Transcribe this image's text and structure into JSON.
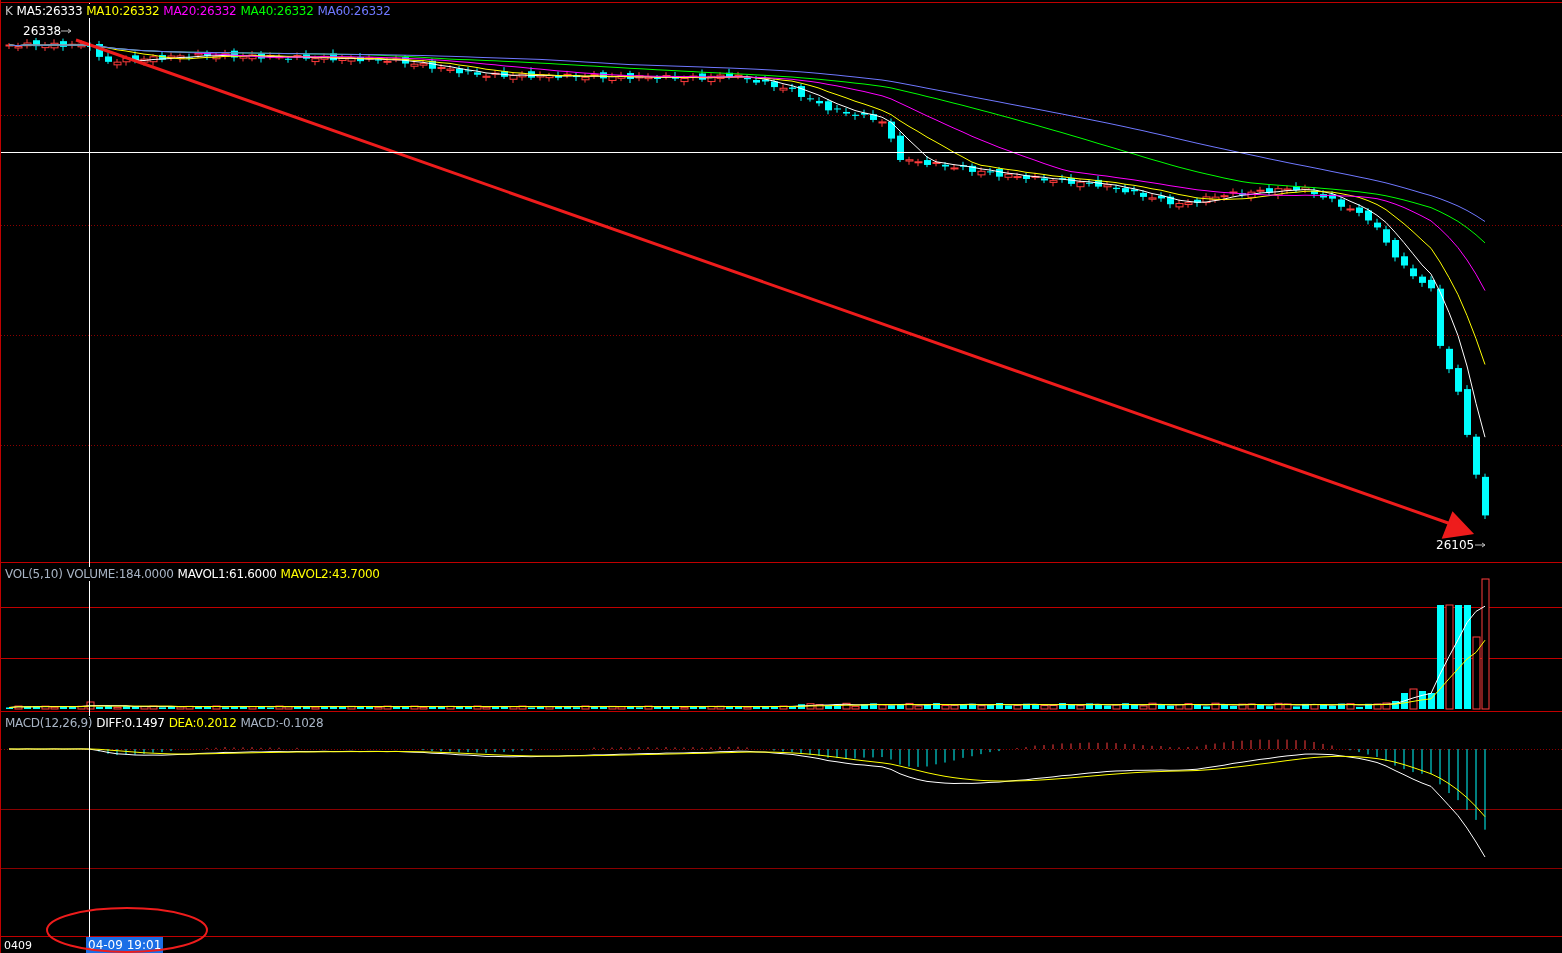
{
  "main": {
    "legend": [
      {
        "label": "K",
        "color": "#c0c0c0"
      },
      {
        "label": "MA5:26333",
        "color": "#ffffff"
      },
      {
        "label": "MA10:26332",
        "color": "#ffff00"
      },
      {
        "label": "MA20:26332",
        "color": "#ff00ff"
      },
      {
        "label": "MA40:26332",
        "color": "#00ff00"
      },
      {
        "label": "MA60:26332",
        "color": "#6f78ff"
      }
    ],
    "high_label": "26338",
    "low_label": "26105"
  },
  "volume": {
    "legend": [
      {
        "label": "VOL(5,10)",
        "color": "#a8b4c4"
      },
      {
        "label": "VOLUME:184.0000",
        "color": "#a8b4c4"
      },
      {
        "label": "MAVOL1:61.6000",
        "color": "#ffffff"
      },
      {
        "label": "MAVOL2:43.7000",
        "color": "#ffff00"
      }
    ]
  },
  "macd": {
    "legend": [
      {
        "label": "MACD(12,26,9)",
        "color": "#a8b4c4"
      },
      {
        "label": "DIFF:0.1497",
        "color": "#ffffff"
      },
      {
        "label": "DEA:0.2012",
        "color": "#ffff00"
      },
      {
        "label": "MACD:-0.1028",
        "color": "#a8b4c4"
      }
    ]
  },
  "time_axis": {
    "date_label": "0409",
    "cursor_label": "04-09 19:01"
  }
}
